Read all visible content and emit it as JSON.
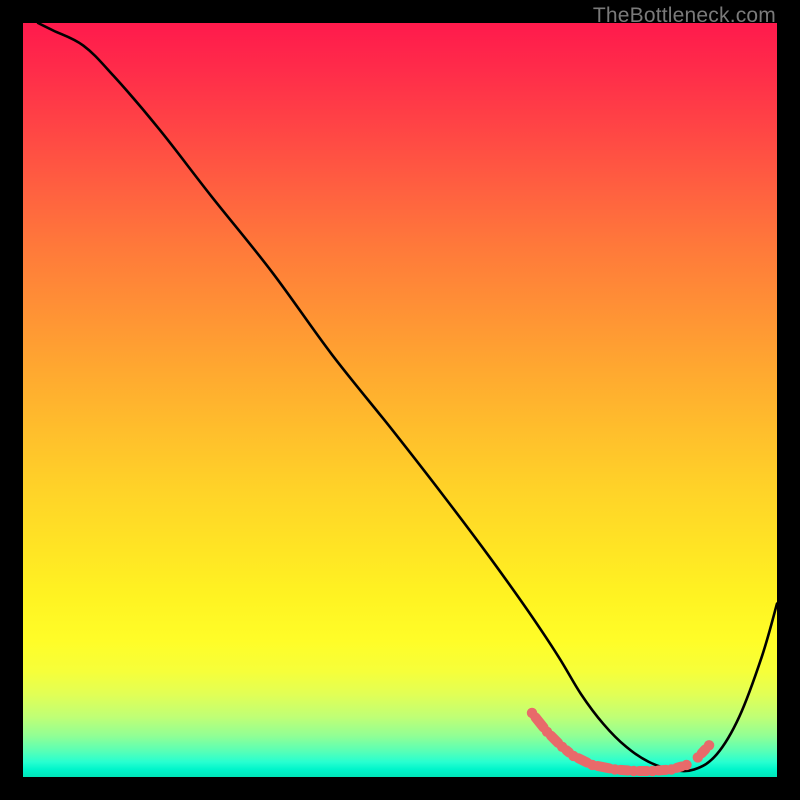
{
  "watermark": "TheBottleneck.com",
  "chart_data": {
    "type": "line",
    "title": "",
    "xlabel": "",
    "ylabel": "",
    "xlim": [
      0,
      100
    ],
    "ylim": [
      0,
      100
    ],
    "grid": false,
    "series": [
      {
        "name": "curve",
        "x": [
          2,
          4,
          8,
          12,
          18,
          25,
          33,
          41,
          49,
          56,
          62,
          67,
          71,
          74,
          77,
          80,
          83,
          86,
          89,
          92,
          95,
          98,
          100
        ],
        "values": [
          100,
          99,
          97,
          93,
          86,
          77,
          67,
          56,
          46,
          37,
          29,
          22,
          16,
          11,
          7,
          4,
          2,
          1,
          1,
          3,
          8,
          16,
          23
        ],
        "color": "#000000"
      }
    ],
    "markers": {
      "name": "segments",
      "color": "#e86a6a",
      "points_x": [
        67.5,
        69.5,
        71.5,
        73,
        75.5,
        78.5,
        81,
        83.5,
        86,
        88,
        89.5,
        91
      ],
      "points_y": [
        8.5,
        6.0,
        4.0,
        2.8,
        1.6,
        1.0,
        0.8,
        0.8,
        1.0,
        1.6,
        2.6,
        4.2
      ]
    }
  }
}
